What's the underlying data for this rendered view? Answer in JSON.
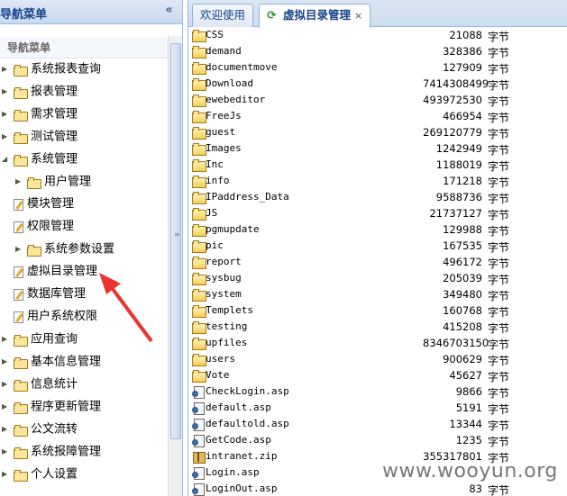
{
  "nav": {
    "header_title": "导航菜单",
    "collapse_icon": "double-chevron-left-icon",
    "sub_title": "导航菜单",
    "items": [
      {
        "label": "系统报表查询",
        "type": "folder",
        "expand": "collapsed",
        "indent": 0
      },
      {
        "label": "报表管理",
        "type": "folder",
        "expand": "collapsed",
        "indent": 0
      },
      {
        "label": "需求管理",
        "type": "folder",
        "expand": "collapsed",
        "indent": 0
      },
      {
        "label": "测试管理",
        "type": "folder",
        "expand": "collapsed",
        "indent": 0
      },
      {
        "label": "系统管理",
        "type": "folder",
        "expand": "expanded",
        "indent": 0
      },
      {
        "label": "用户管理",
        "type": "folder",
        "expand": "collapsed",
        "indent": 1
      },
      {
        "label": "模块管理",
        "type": "leaf",
        "expand": "",
        "indent": 0
      },
      {
        "label": "权限管理",
        "type": "leaf",
        "expand": "",
        "indent": 0
      },
      {
        "label": "系统参数设置",
        "type": "folder",
        "expand": "collapsed",
        "indent": 1
      },
      {
        "label": "虚拟目录管理",
        "type": "leaf",
        "expand": "",
        "indent": 0
      },
      {
        "label": "数据库管理",
        "type": "leaf",
        "expand": "",
        "indent": 0
      },
      {
        "label": "用户系统权限",
        "type": "leaf",
        "expand": "",
        "indent": 0
      },
      {
        "label": "应用查询",
        "type": "folder",
        "expand": "collapsed",
        "indent": 0
      },
      {
        "label": "基本信息管理",
        "type": "folder",
        "expand": "collapsed",
        "indent": 0
      },
      {
        "label": "信息统计",
        "type": "folder",
        "expand": "collapsed",
        "indent": 0
      },
      {
        "label": "程序更新管理",
        "type": "folder",
        "expand": "collapsed",
        "indent": 0
      },
      {
        "label": "公文流转",
        "type": "folder",
        "expand": "collapsed",
        "indent": 0
      },
      {
        "label": "系统报障管理",
        "type": "folder",
        "expand": "collapsed",
        "indent": 0
      },
      {
        "label": "个人设置",
        "type": "folder",
        "expand": "collapsed",
        "indent": 0
      }
    ]
  },
  "tabs": [
    {
      "label": "欢迎使用",
      "active": false
    },
    {
      "label": "虚拟目录管理",
      "active": true,
      "icon": "refresh-icon",
      "close_icon": "close-icon"
    }
  ],
  "files": {
    "unit": "字节",
    "rows": [
      {
        "name": "CSS",
        "size": "21088",
        "kind": "folder"
      },
      {
        "name": "demand",
        "size": "328386",
        "kind": "folder"
      },
      {
        "name": "documentmove",
        "size": "127909",
        "kind": "folder"
      },
      {
        "name": "Download",
        "size": "7414308499",
        "kind": "folder"
      },
      {
        "name": "ewebeditor",
        "size": "493972530",
        "kind": "folder"
      },
      {
        "name": "FreeJs",
        "size": "466954",
        "kind": "folder"
      },
      {
        "name": "guest",
        "size": "269120779",
        "kind": "folder"
      },
      {
        "name": "Images",
        "size": "1242949",
        "kind": "folder"
      },
      {
        "name": "Inc",
        "size": "1188019",
        "kind": "folder"
      },
      {
        "name": "info",
        "size": "171218",
        "kind": "folder"
      },
      {
        "name": "IPaddress_Data",
        "size": "9588736",
        "kind": "folder"
      },
      {
        "name": "JS",
        "size": "21737127",
        "kind": "folder"
      },
      {
        "name": "pgmupdate",
        "size": "129988",
        "kind": "folder"
      },
      {
        "name": "pic",
        "size": "167535",
        "kind": "folder"
      },
      {
        "name": "report",
        "size": "496172",
        "kind": "folder"
      },
      {
        "name": "sysbug",
        "size": "205039",
        "kind": "folder"
      },
      {
        "name": "system",
        "size": "349480",
        "kind": "folder"
      },
      {
        "name": "Templets",
        "size": "160768",
        "kind": "folder"
      },
      {
        "name": "testing",
        "size": "415208",
        "kind": "folder"
      },
      {
        "name": "upfiles",
        "size": "8346703150",
        "kind": "folder"
      },
      {
        "name": "users",
        "size": "900629",
        "kind": "folder"
      },
      {
        "name": "Vote",
        "size": "45627",
        "kind": "folder"
      },
      {
        "name": "CheckLogin.asp",
        "size": "9866",
        "kind": "file"
      },
      {
        "name": "default.asp",
        "size": "5191",
        "kind": "file"
      },
      {
        "name": "defaultold.asp",
        "size": "13344",
        "kind": "file"
      },
      {
        "name": "GetCode.asp",
        "size": "1235",
        "kind": "file"
      },
      {
        "name": "intranet.zip",
        "size": "355317801",
        "kind": "zip"
      },
      {
        "name": "Login.asp",
        "size": "",
        "kind": "file"
      },
      {
        "name": "LoginOut.asp",
        "size": "83",
        "kind": "file"
      }
    ]
  },
  "watermark": "www.wooyun.org",
  "colors": {
    "accent": "#15428b",
    "border": "#99bbe8",
    "annotation_arrow": "#e8352e"
  }
}
